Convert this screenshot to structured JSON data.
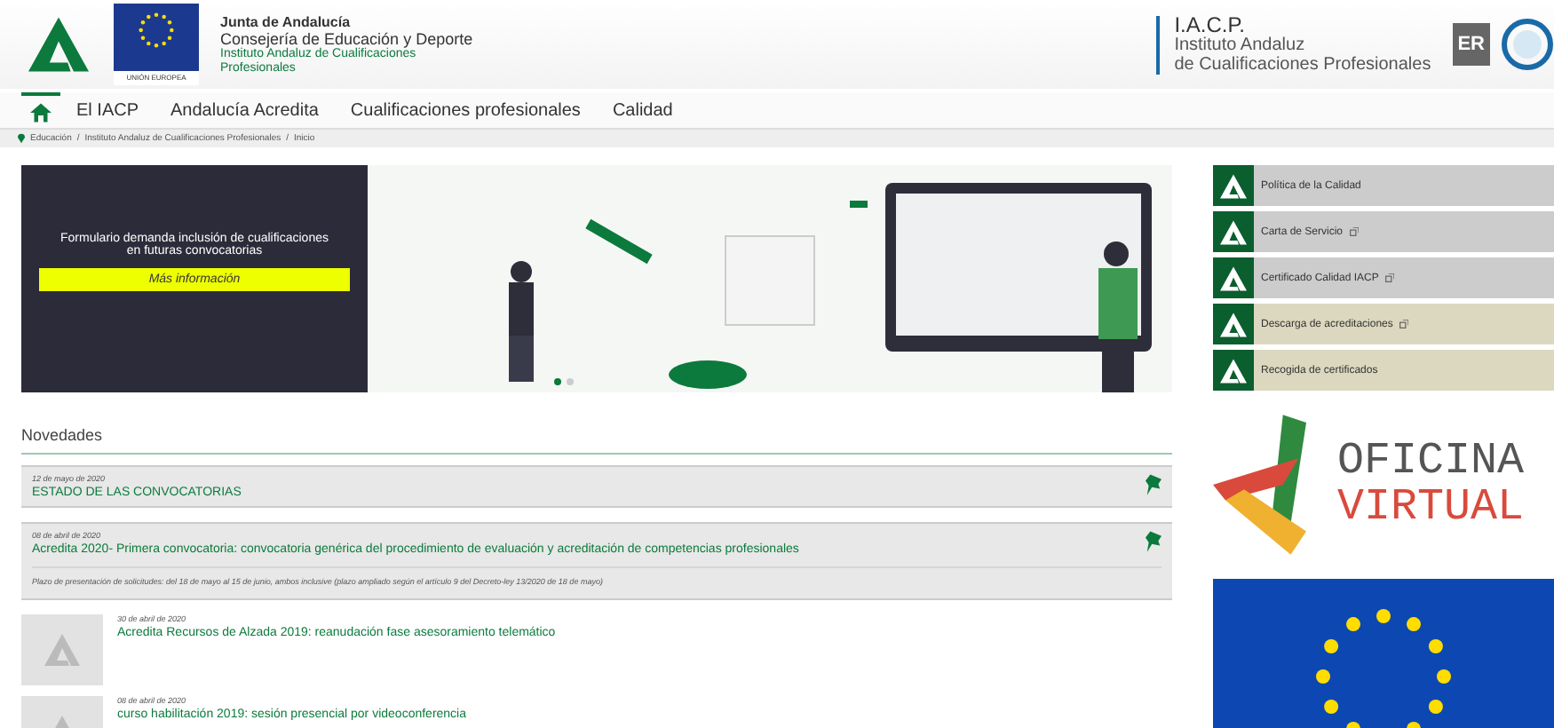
{
  "header": {
    "org": "Junta de Andalucía",
    "department": "Consejería de Educación y Deporte",
    "institute": "Instituto Andaluz de Cualificaciones Profesionales",
    "eu_label": "UNIÓN EUROPEA",
    "brand_title": "I.A.C.P.",
    "brand_line1": "Instituto Andaluz",
    "brand_line2": "de Cualificaciones Profesionales",
    "badge_text": "ER"
  },
  "nav": [
    {
      "kind": "home",
      "selected": true
    },
    {
      "kind": "text",
      "label": "El IACP",
      "selected": false
    },
    {
      "kind": "text",
      "label": "Andalucía Acredita",
      "selected": false
    },
    {
      "kind": "text",
      "label": "Cualificaciones profesionales",
      "selected": false
    },
    {
      "kind": "text",
      "label": "Calidad",
      "selected": false
    }
  ],
  "breadcrumb": [
    {
      "label": "Educación",
      "separator": "/"
    },
    {
      "label": "Instituto Andaluz de Cualificaciones Profesionales",
      "separator": "/"
    },
    {
      "label": "Inicio"
    }
  ],
  "banner": {
    "text": "Formulario demanda inclusión de cualificaciones en futuras convocatorias",
    "button": "Más información",
    "dots": [
      {
        "selected": true
      },
      {
        "selected": false
      }
    ]
  },
  "news": {
    "title": "Novedades",
    "items": [
      {
        "kind": "pinned",
        "date": "12 de mayo de 2020",
        "title": "ESTADO DE LAS CONVOCATORIAS"
      },
      {
        "kind": "pinned",
        "date": "08 de abril de 2020",
        "title": "Acredita 2020- Primera convocatoria: convocatoria genérica del procedimiento de evaluación y acreditación de competencias profesionales",
        "summary": "Plazo de presentación de solicitudes: del 18 de mayo al 15 de junio, ambos inclusive (plazo ampliado según el artículo 9 del Decreto-ley 13/2020 de 18 de mayo)"
      },
      {
        "kind": "thumb",
        "date": "30 de abril de 2020",
        "title": "Acredita Recursos de Alzada 2019: reanudación fase asesoramiento telemático"
      },
      {
        "kind": "thumb",
        "date": "08 de abril de 2020",
        "title": "curso habilitación 2019: sesión presencial por videoconferencia"
      }
    ]
  },
  "side_links": [
    {
      "label": "Política de la Calidad",
      "external": false,
      "color": "#cccccc"
    },
    {
      "label": "Carta de Servicio",
      "external": true,
      "color": "#cccccc"
    },
    {
      "label": "Certificado Calidad IACP",
      "external": true,
      "color": "#cccccc"
    },
    {
      "label": "Descarga de acreditaciones",
      "external": true,
      "color": "#dcd8bf"
    },
    {
      "label": "Recogida de certificados",
      "external": false,
      "color": "#dcd8bf"
    }
  ],
  "virtual_office": {
    "line1": "OFICINA",
    "line2": "VIRTUAL"
  }
}
